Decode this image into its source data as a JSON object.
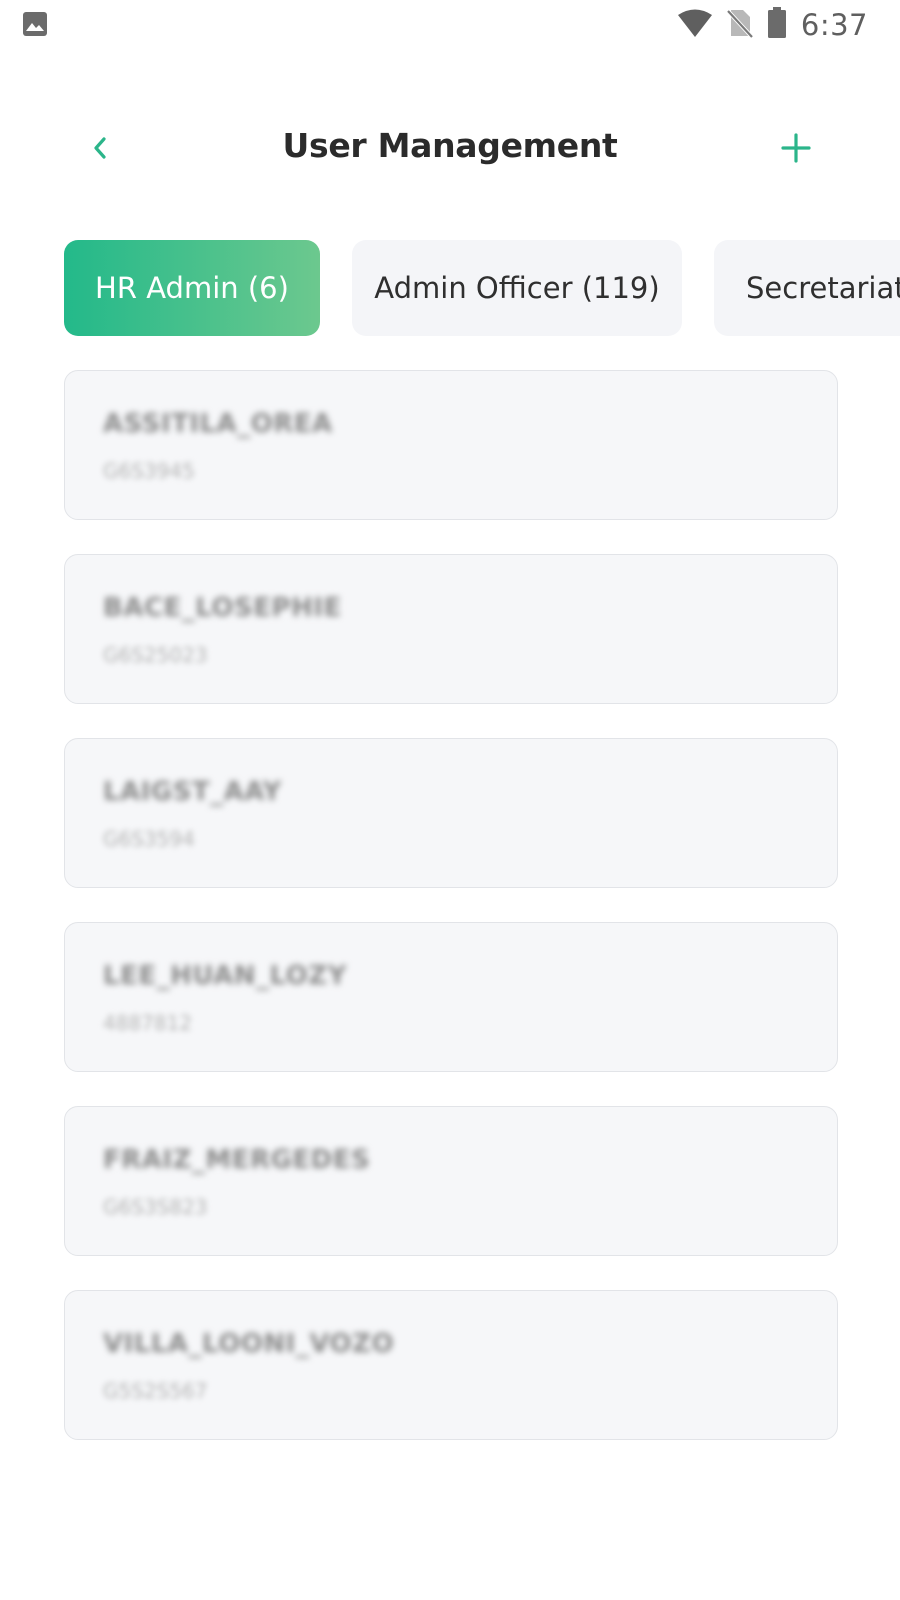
{
  "status_bar": {
    "time": "6:37",
    "icons": [
      "image-icon",
      "wifi-icon",
      "no-sim-icon",
      "battery-icon"
    ]
  },
  "header": {
    "title": "User Management",
    "back_icon": "chevron-left-icon",
    "add_icon": "plus-icon"
  },
  "colors": {
    "accent": "#23b98a",
    "accent_gradient_end": "#6cc88e",
    "card_bg": "#f6f7f9",
    "tab_inactive_bg": "#f4f5f8",
    "title": "#2b2b2b"
  },
  "tabs": [
    {
      "label": "HR Admin (6)",
      "active": true
    },
    {
      "label": "Admin Officer (119)",
      "active": false
    },
    {
      "label": "Secretariat",
      "active": false
    }
  ],
  "users": [
    {
      "name": "ASSITILA_OREA",
      "id": "G6S3945"
    },
    {
      "name": "BACE_LOSEPHIE",
      "id": "G6S25023"
    },
    {
      "name": "LAIGST_AAY",
      "id": "G6S3594"
    },
    {
      "name": "LEE_HUAN_LOZY",
      "id": "4887812"
    },
    {
      "name": "FRAIZ_MERGEDES",
      "id": "G6S3S823"
    },
    {
      "name": "VILLA_LOONI_VOZO",
      "id": "G5S2S567"
    }
  ]
}
